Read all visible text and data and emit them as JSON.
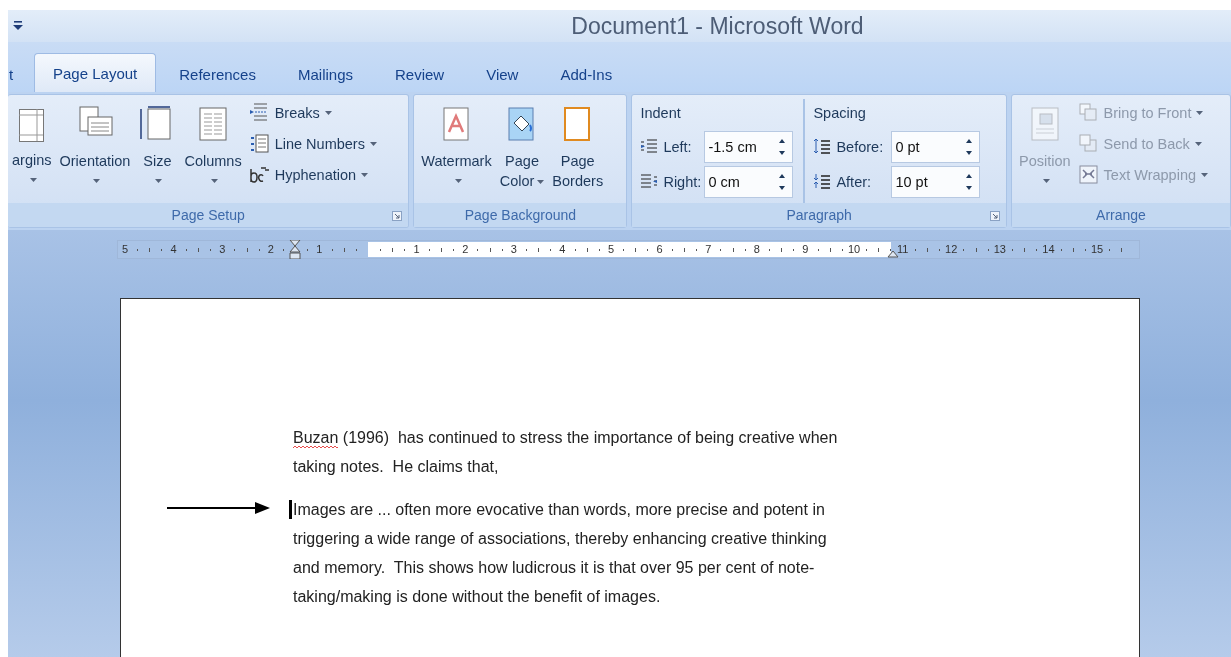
{
  "window": {
    "title": "Document1 - Microsoft Word"
  },
  "tabs": [
    {
      "label": "t",
      "selected": false
    },
    {
      "label": "Page Layout",
      "selected": true
    },
    {
      "label": "References",
      "selected": false
    },
    {
      "label": "Mailings",
      "selected": false
    },
    {
      "label": "Review",
      "selected": false
    },
    {
      "label": "View",
      "selected": false
    },
    {
      "label": "Add-Ins",
      "selected": false
    }
  ],
  "ribbon": {
    "groups": [
      {
        "kind": "buttons",
        "label": "Page Setup",
        "launcher": true,
        "large_buttons": [
          {
            "label_lines": [
              "argins"
            ],
            "caret": true,
            "disabled": false
          },
          {
            "label_lines": [
              "Orientation"
            ],
            "caret": true,
            "disabled": false
          },
          {
            "label_lines": [
              "Size"
            ],
            "caret": true,
            "disabled": false
          },
          {
            "label_lines": [
              "Columns"
            ],
            "caret": true,
            "disabled": false
          }
        ],
        "small_buttons": [
          {
            "label": "Breaks",
            "caret": true,
            "disabled": false
          },
          {
            "label": "Line Numbers",
            "caret": true,
            "disabled": false
          },
          {
            "label": "Hyphenation",
            "caret": true,
            "disabled": false
          }
        ]
      },
      {
        "kind": "buttons",
        "label": "Page Background",
        "launcher": false,
        "large_buttons": [
          {
            "label_lines": [
              "Watermark"
            ],
            "caret": true,
            "disabled": false
          },
          {
            "label_lines": [
              "Page",
              "Color"
            ],
            "caret": true,
            "disabled": false
          },
          {
            "label_lines": [
              "Page",
              "Borders"
            ],
            "caret": false,
            "disabled": false
          }
        ]
      },
      {
        "kind": "paragraph",
        "label": "Paragraph",
        "launcher": true,
        "sections": [
          {
            "title": "Indent",
            "fields": [
              {
                "label": "Left:",
                "value": "-1.5 cm"
              },
              {
                "label": "Right:",
                "value": "0 cm"
              }
            ]
          },
          {
            "title": "Spacing",
            "fields": [
              {
                "label": "Before:",
                "value": "0 pt"
              },
              {
                "label": "After:",
                "value": "10 pt"
              }
            ]
          }
        ]
      },
      {
        "kind": "buttons",
        "label": "Arrange",
        "launcher": false,
        "large_buttons": [
          {
            "label_lines": [
              "Position"
            ],
            "caret": true,
            "disabled": true
          }
        ],
        "small_buttons": [
          {
            "label": "Bring to Front",
            "caret": true,
            "disabled": true
          },
          {
            "label": "Send to Back",
            "caret": true,
            "disabled": true
          },
          {
            "label": "Text Wrapping",
            "caret": true,
            "disabled": true
          }
        ]
      }
    ]
  },
  "ruler": {
    "left_numbers": [
      "5",
      "4",
      "3",
      "2",
      "1"
    ],
    "text_numbers": [
      "1",
      "2",
      "3",
      "4",
      "5",
      "6",
      "7",
      "8",
      "9",
      "10"
    ],
    "right_numbers": [
      "11",
      "12",
      "13",
      "14",
      "15"
    ]
  },
  "document": {
    "paragraphs": [
      {
        "parts": [
          {
            "text": "Buzan",
            "misspelled": true
          },
          {
            "text": " (1996)  has continued to stress the importance of being creative when taking notes.  He claims that,",
            "misspelled": false
          }
        ],
        "cursor": false,
        "arrow": false
      },
      {
        "parts": [
          {
            "text": "Images are ... often more evocative than words, more precise and potent in triggering a wide range of associations, thereby enhancing creative thinking and memory.  This shows how ludicrous it is that over 95 per cent of note-taking/making is done without the benefit of images.",
            "misspelled": false
          }
        ],
        "cursor": true,
        "arrow": true
      }
    ]
  }
}
